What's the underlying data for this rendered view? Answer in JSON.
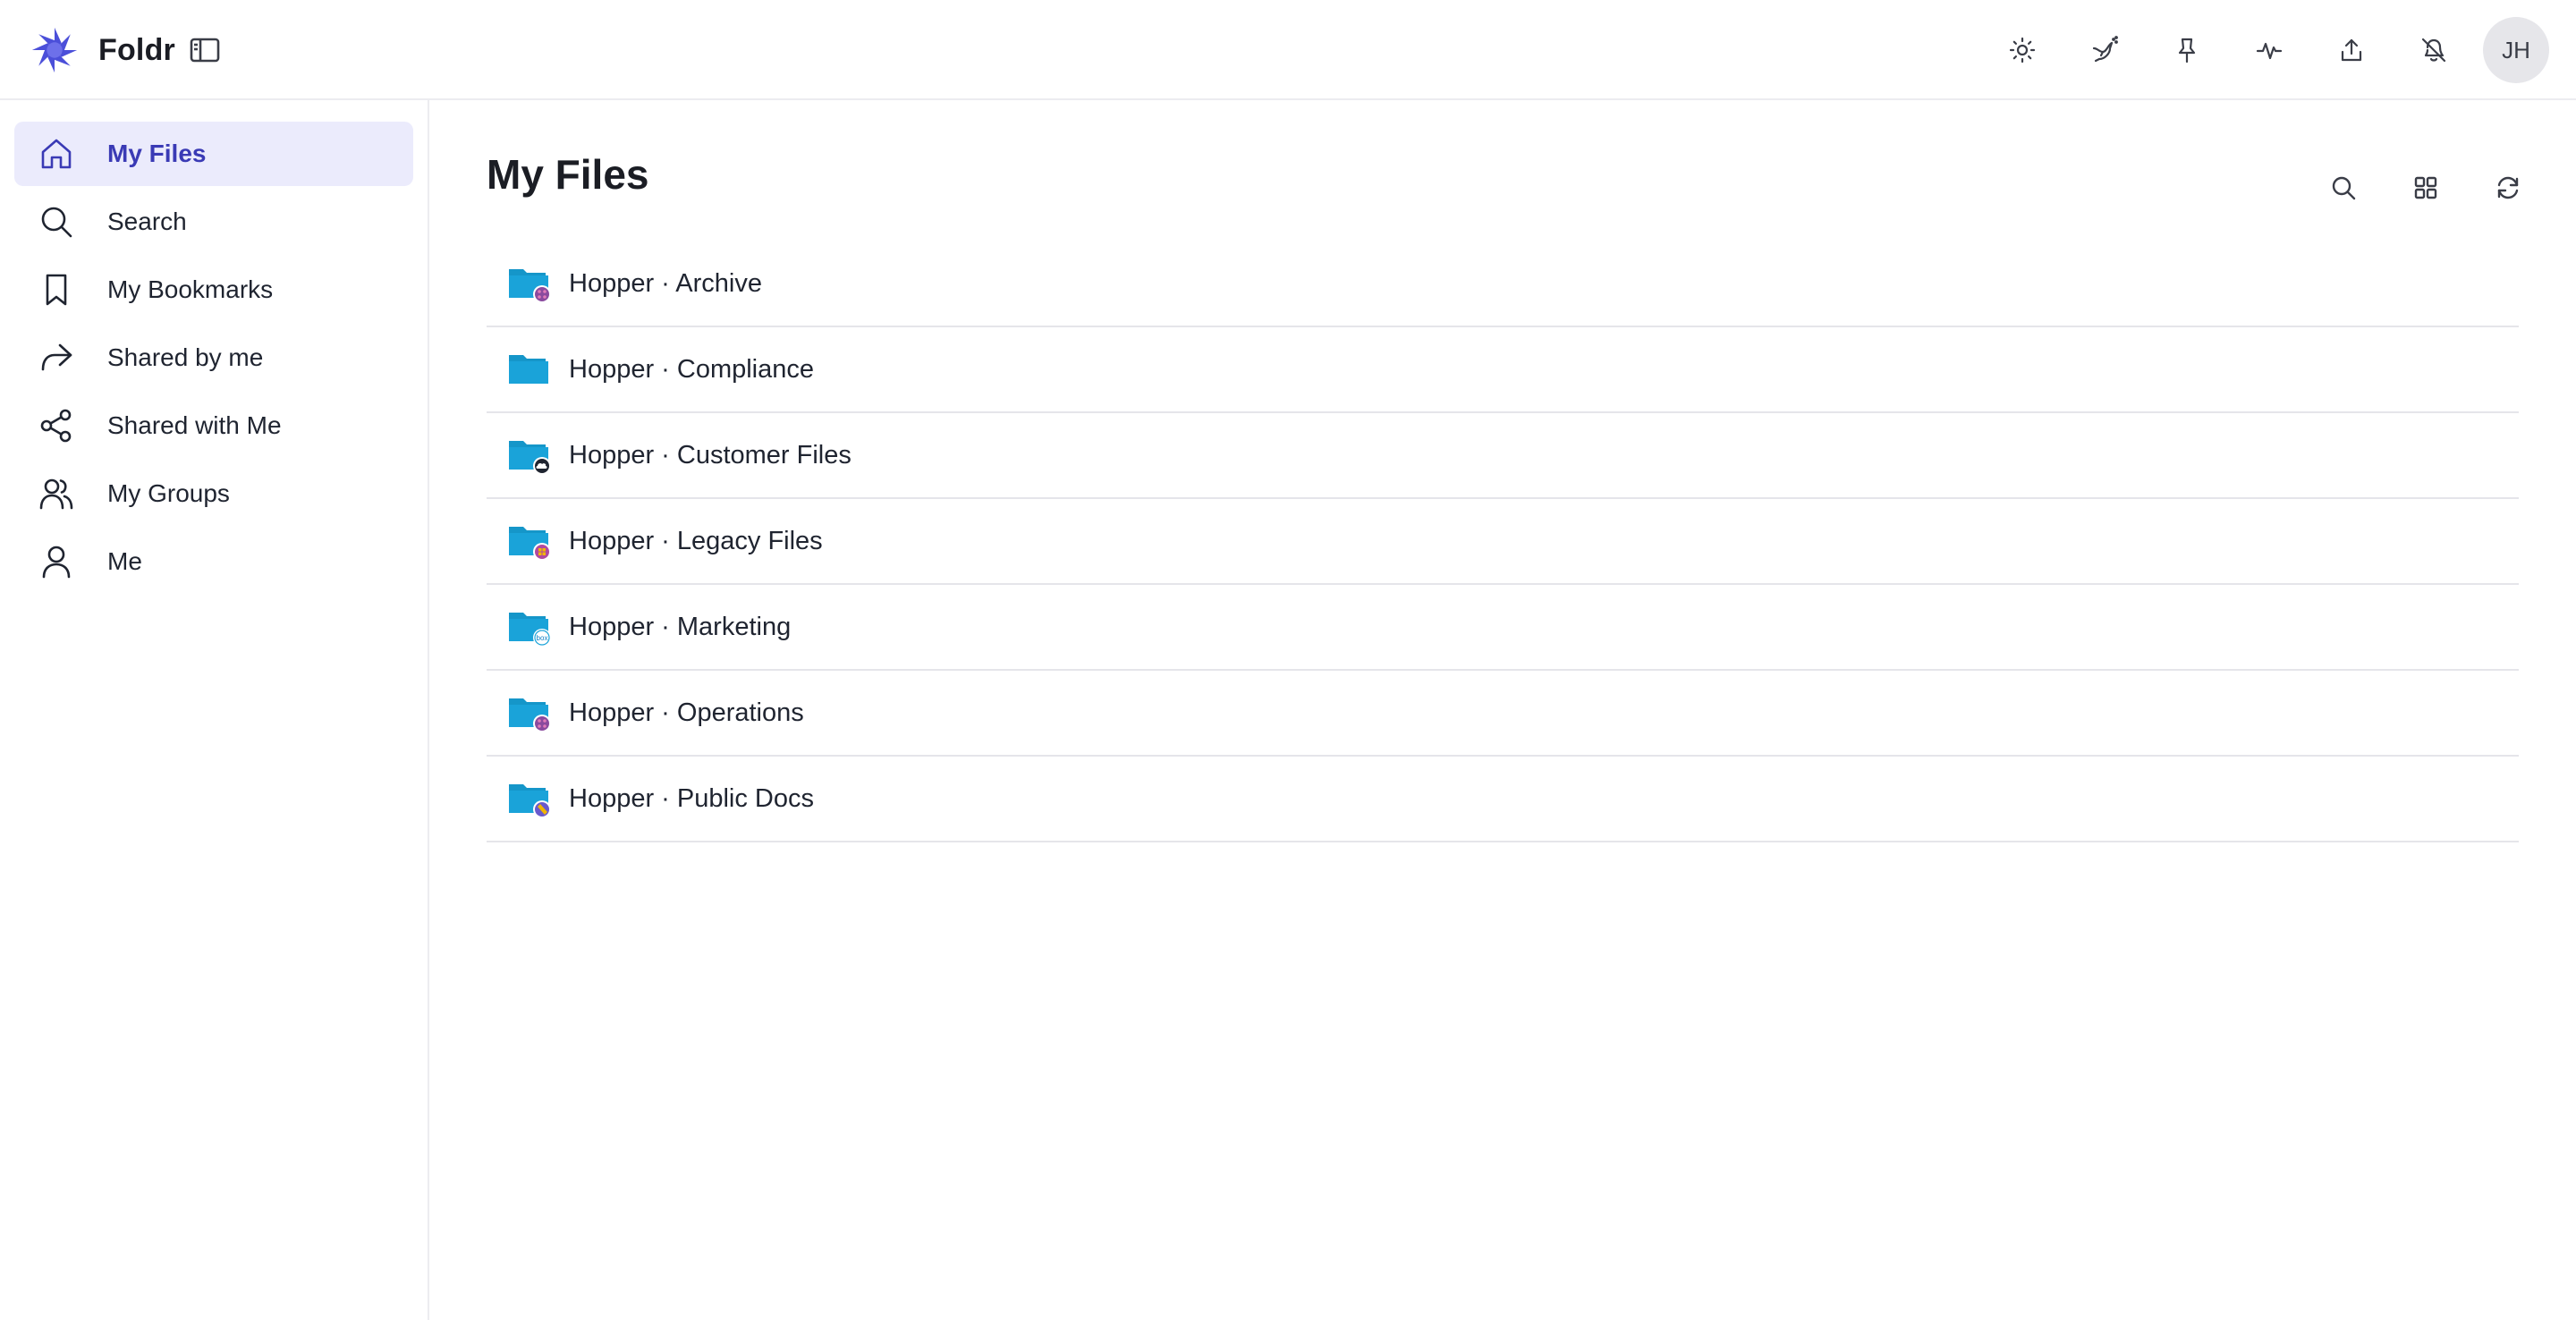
{
  "app": {
    "name": "Foldr"
  },
  "topbar": {
    "icons": [
      "sun-icon",
      "bird-icon",
      "pin-icon",
      "activity-icon",
      "upload-icon",
      "bell-off-icon"
    ],
    "avatar_initials": "JH"
  },
  "sidebar": {
    "items": [
      {
        "label": "My Files",
        "icon": "home-icon",
        "active": true
      },
      {
        "label": "Search",
        "icon": "search-icon"
      },
      {
        "label": "My Bookmarks",
        "icon": "bookmark-icon"
      },
      {
        "label": "Shared by me",
        "icon": "share-forward-icon"
      },
      {
        "label": "Shared with Me",
        "icon": "share-nodes-icon"
      },
      {
        "label": "My Groups",
        "icon": "users-icon"
      },
      {
        "label": "Me",
        "icon": "user-icon"
      }
    ]
  },
  "main": {
    "title": "My Files",
    "actions": [
      "search-icon",
      "grid-icon",
      "refresh-icon"
    ],
    "files": [
      {
        "name": "Hopper · Archive",
        "badge": "purple-dots"
      },
      {
        "name": "Hopper · Compliance",
        "badge": "none"
      },
      {
        "name": "Hopper · Customer Files",
        "badge": "cloud"
      },
      {
        "name": "Hopper · Legacy Files",
        "badge": "windows"
      },
      {
        "name": "Hopper · Marketing",
        "badge": "box"
      },
      {
        "name": "Hopper · Operations",
        "badge": "purple-dots"
      },
      {
        "name": "Hopper · Public Docs",
        "badge": "pencil"
      }
    ]
  },
  "colors": {
    "accent": "#3a3ab5",
    "active_bg": "#ebebfc",
    "folder": "#1aa3d9",
    "logo": "#4b4fd9"
  }
}
